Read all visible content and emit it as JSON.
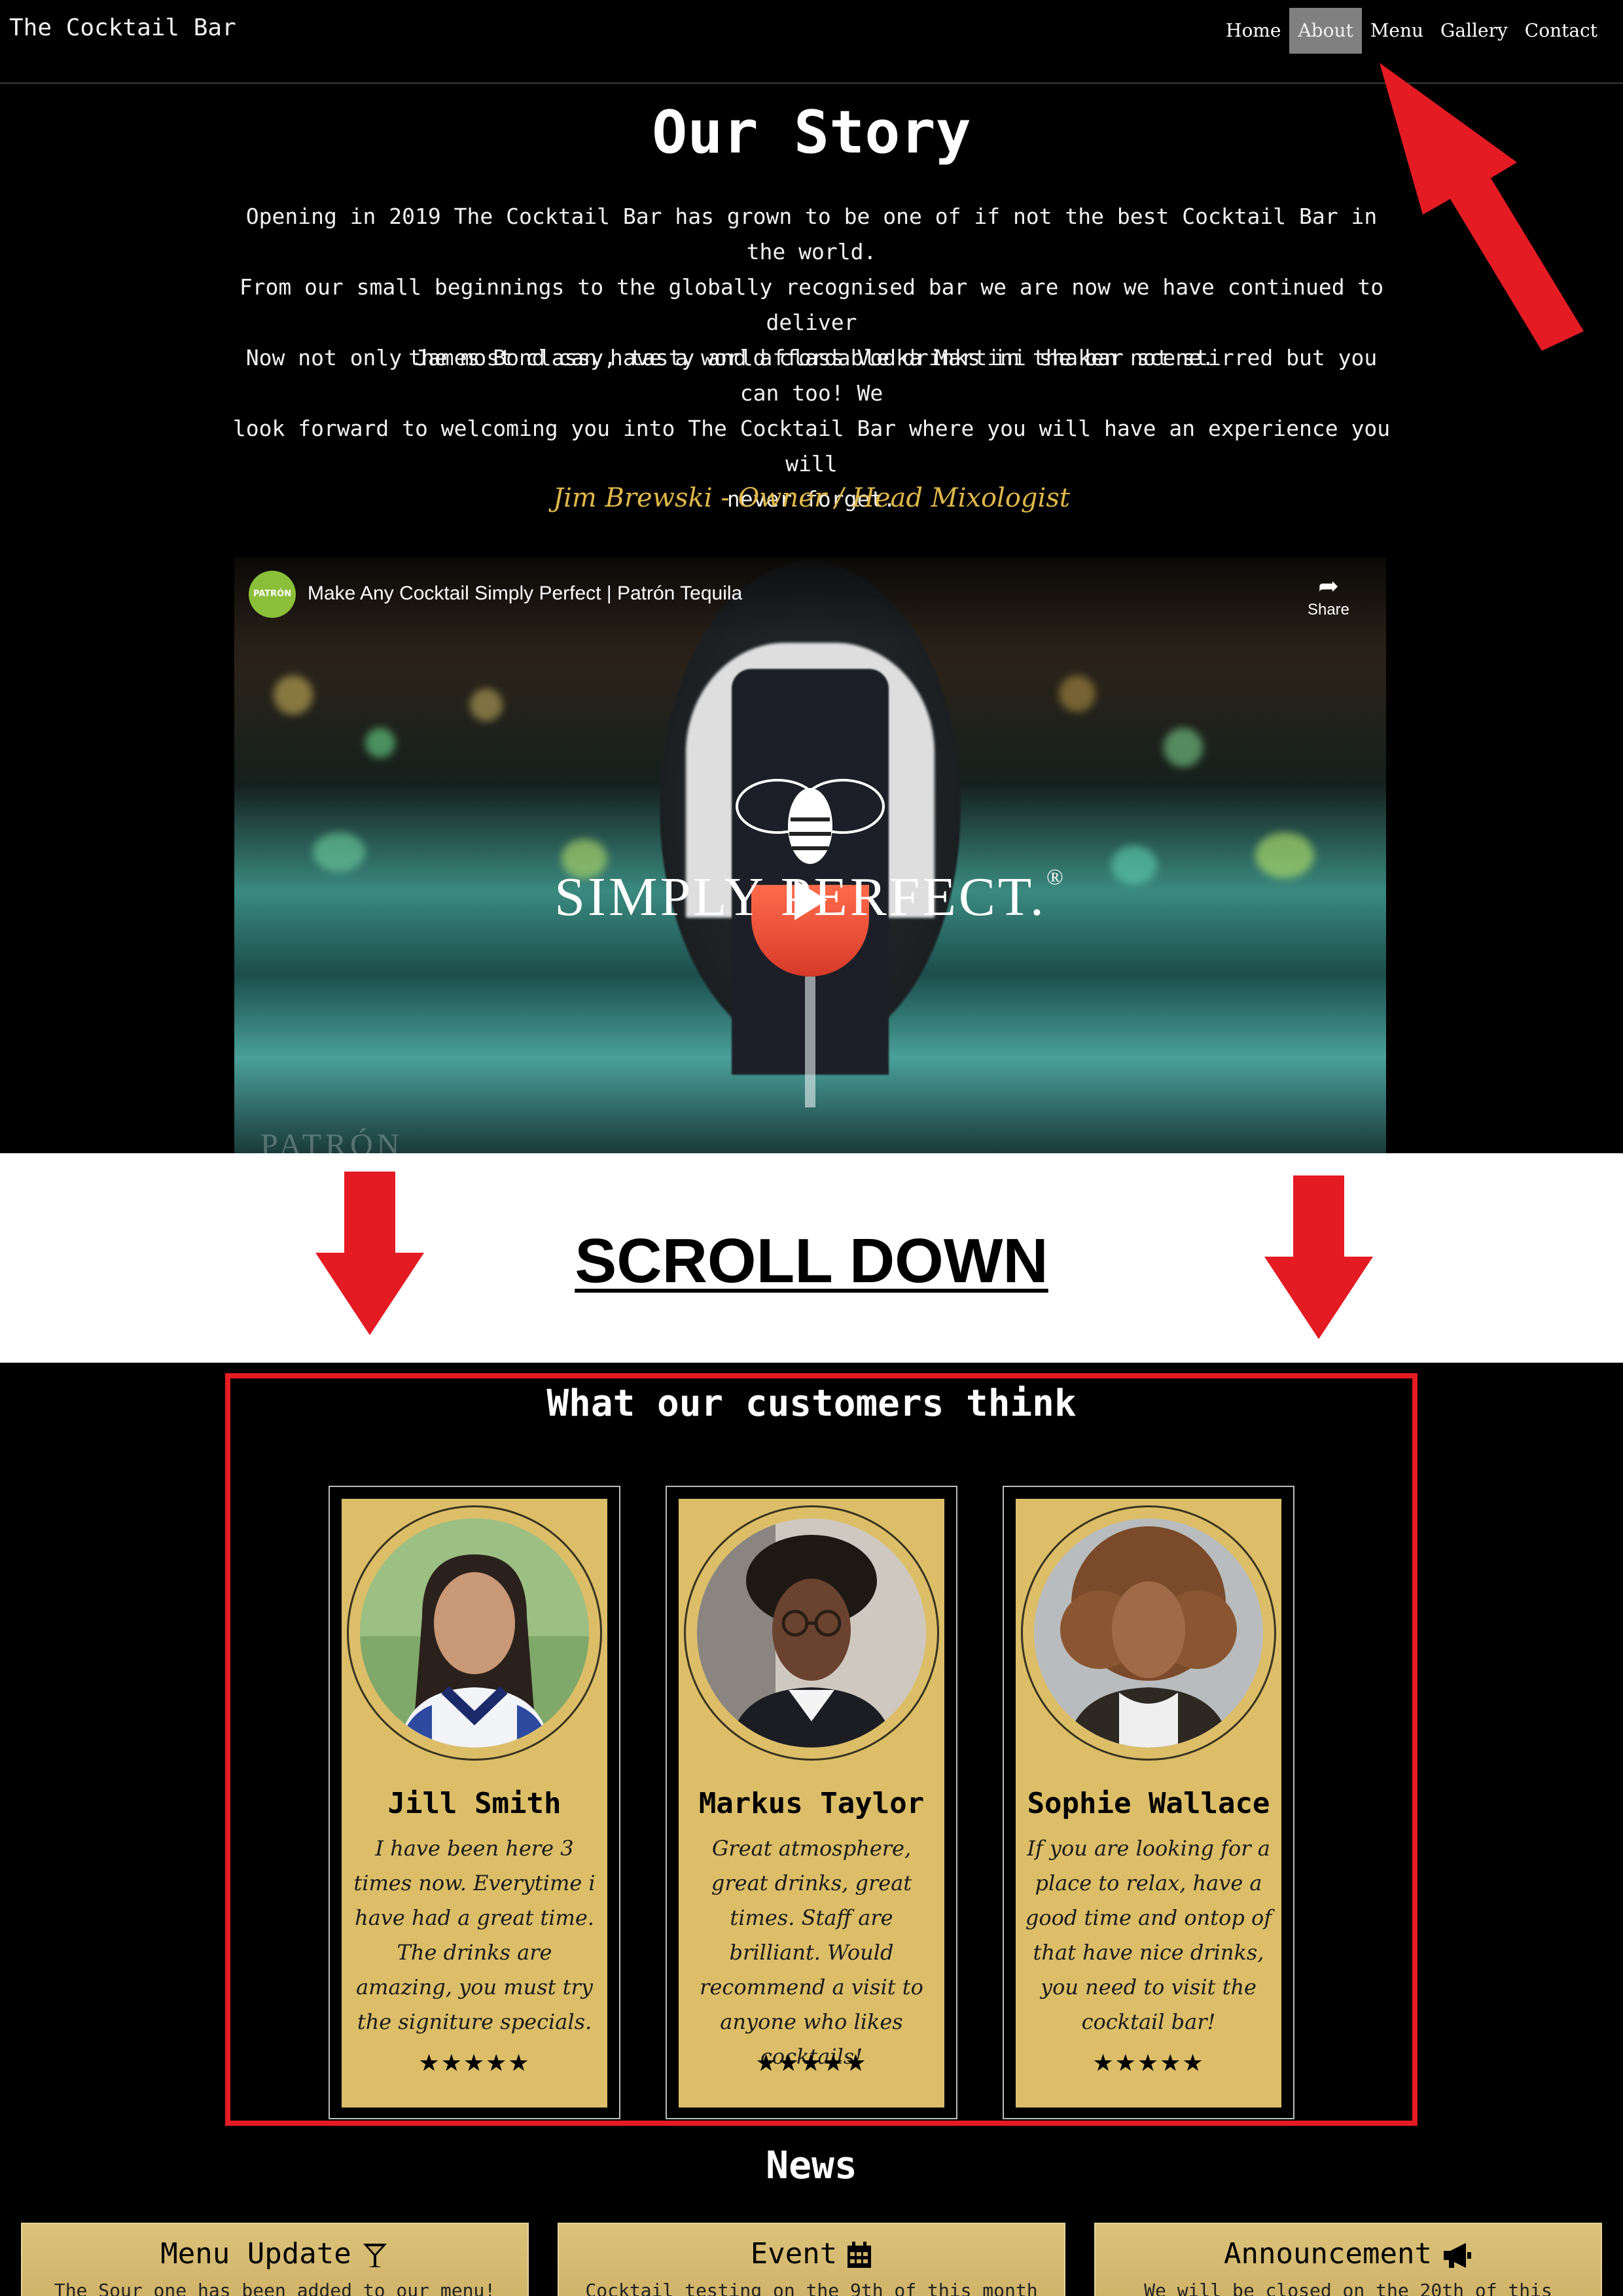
{
  "navbar": {
    "brand": "The Cocktail Bar",
    "links": [
      {
        "label": "Home",
        "active": false
      },
      {
        "label": "About",
        "active": true
      },
      {
        "label": "Menu",
        "active": false
      },
      {
        "label": "Gallery",
        "active": false
      },
      {
        "label": "Contact",
        "active": false
      }
    ]
  },
  "story": {
    "title": "Our Story",
    "paragraph_1": [
      "Opening in 2019 The Cocktail Bar has grown to be one of if not the best Cocktail Bar in the world.",
      "From our small beginnings to the globally recognised bar we are now we have continued to deliver",
      "the most classy, tasty and affordable drinks in the bar scene."
    ],
    "paragraph_2": [
      "Now not only James Bond can have a world class Vodka Martini shaken not stirred but you can too! We",
      "look forward to welcoming you into The Cocktail Bar where you will have an experience you will",
      "never forget."
    ],
    "signature": "Jim Brewski - Owner / Head Mixologist"
  },
  "video": {
    "channel_logo_text": "PATRÓN",
    "title": "Make Any Cocktail Simply Perfect | Patrón Tequila",
    "share_label": "Share",
    "overlay_text": "SIMPLY PERFECT.",
    "registered_mark": "®",
    "watermark": "PATRÓN"
  },
  "annotation": {
    "scroll_label": "SCROLL DOWN",
    "arrow_color": "#e41b23"
  },
  "testimonials": {
    "title": "What our customers think",
    "cards": [
      {
        "name": "Jill Smith",
        "quote": "I have been here 3 times now. Everytime i have had a great time. The drinks are amazing, you must try the signiture specials.",
        "rating": 5,
        "stars": "★★★★★"
      },
      {
        "name": "Markus Taylor",
        "quote": "Great atmosphere, great drinks, great times. Staff are brilliant. Would recommend a visit to anyone who likes cocktails!",
        "rating": 5,
        "stars": "★★★★★"
      },
      {
        "name": "Sophie Wallace",
        "quote": "If you are looking for a place to relax, have a good time and ontop of that have nice drinks, you need to visit the cocktail bar!",
        "rating": 5,
        "stars": "★★★★★"
      }
    ]
  },
  "news": {
    "title": "News",
    "items": [
      {
        "heading": "Menu Update",
        "icon": "cocktail-glass-icon",
        "body": "The Sour one has been added to our menu!"
      },
      {
        "heading": "Event",
        "icon": "calendar-icon",
        "body": "Cocktail testing on the 9th of this month"
      },
      {
        "heading": "Announcement",
        "icon": "megaphone-icon",
        "body": "We will be closed on the 20th of this"
      }
    ]
  },
  "colors": {
    "background": "#000000",
    "card_gold": "#dcbe69",
    "signature_gold": "#e0b84a",
    "nav_active": "#808080",
    "highlight_red": "#e41b23"
  }
}
